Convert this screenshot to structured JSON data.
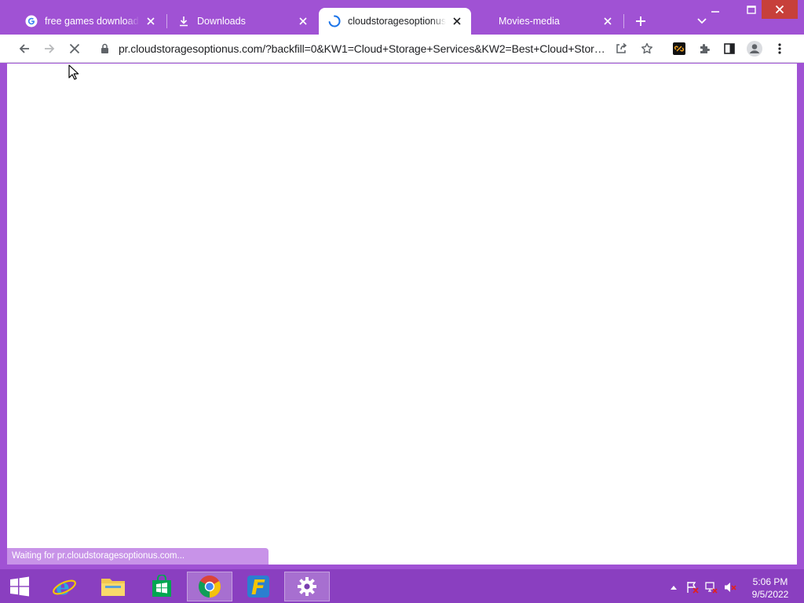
{
  "browser": {
    "tabs": [
      {
        "title": "free games download co",
        "favicon": "google-g-icon",
        "active": false
      },
      {
        "title": "Downloads",
        "favicon": "download-icon",
        "active": false
      },
      {
        "title": "cloudstoragesoptionus.c",
        "favicon": "loading-spinner-icon",
        "active": true
      },
      {
        "title": "Movies-media",
        "favicon": "none",
        "active": false
      }
    ],
    "url": "pr.cloudstoragesoptionus.com/?backfill=0&KW1=Cloud+Storage+Services&KW2=Best+Cloud+Storage+Options&KW3=Cloud+Sto...",
    "status_text": "Waiting for pr.cloudstoragesoptionus.com...",
    "loading": true
  },
  "taskbar": {
    "apps": [
      "start-button",
      "internet-explorer-icon",
      "file-explorer-icon",
      "store-icon",
      "chrome-icon",
      "f-app-icon",
      "settings-icon"
    ],
    "clock": {
      "time": "5:06 PM",
      "date": "9/5/2022"
    }
  },
  "colors": {
    "frame": "#a052d4",
    "taskbar": "#8a3fc0",
    "status_bubble": "#c893e8",
    "close_button": "#c7403a"
  }
}
